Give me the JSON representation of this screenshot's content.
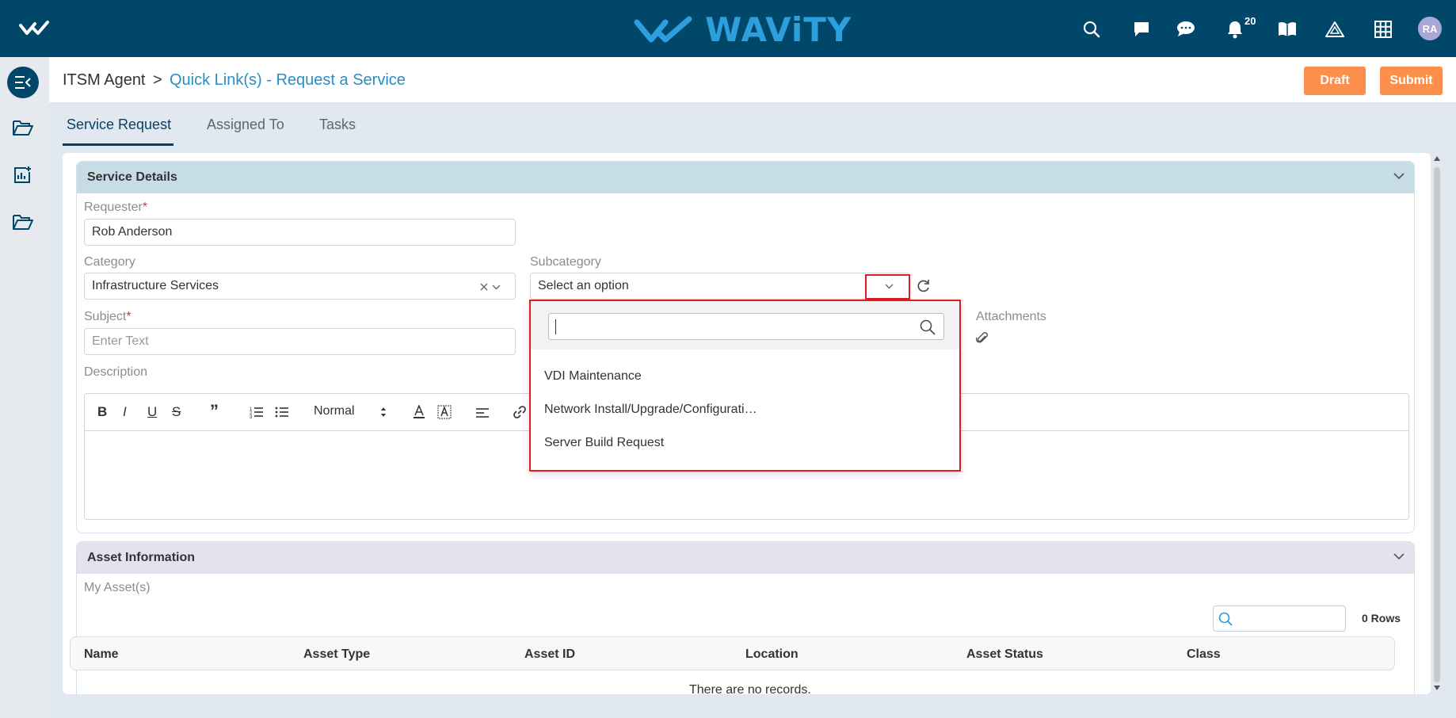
{
  "brand": {
    "name": "WAViTY"
  },
  "topbar": {
    "icons": [
      "search-icon",
      "chat-square-icon",
      "chat-bubble-icon",
      "bell-icon",
      "book-icon",
      "warning-icon",
      "apps-grid-icon"
    ],
    "notification_count": "20",
    "avatar_initials": "RA"
  },
  "breadcrumb": {
    "root": "ITSM Agent",
    "separator": ">",
    "current": "Quick Link(s) - Request a Service"
  },
  "actions": {
    "draft": "Draft",
    "submit": "Submit"
  },
  "tabs": [
    "Service Request",
    "Assigned To",
    "Tasks"
  ],
  "service_details": {
    "title": "Service Details",
    "requester_label": "Requester",
    "requester_value": "Rob Anderson",
    "category_label": "Category",
    "category_value": "Infrastructure Services",
    "subcategory_label": "Subcategory",
    "subcategory_placeholder": "Select an option",
    "subject_label": "Subject",
    "subject_placeholder": "Enter Text",
    "attachments_label": "Attachments",
    "description_label": "Description",
    "editor_format": "Normal",
    "required_mark": "*"
  },
  "subcategory_dropdown": {
    "options": [
      "VDI Maintenance",
      "Network Install/Upgrade/Configurati…",
      "Server Build Request"
    ]
  },
  "asset_info": {
    "title": "Asset Information",
    "subtitle": "My Asset(s)",
    "rows_count": "0 Rows",
    "columns": [
      "Name",
      "Asset Type",
      "Asset ID",
      "Location",
      "Asset Status",
      "Class"
    ],
    "empty_message": "There are no records."
  },
  "colors": {
    "topbar": "#00476a",
    "accent": "#fd8f4d",
    "link": "#2c8cc4",
    "highlight": "#e11b22"
  }
}
